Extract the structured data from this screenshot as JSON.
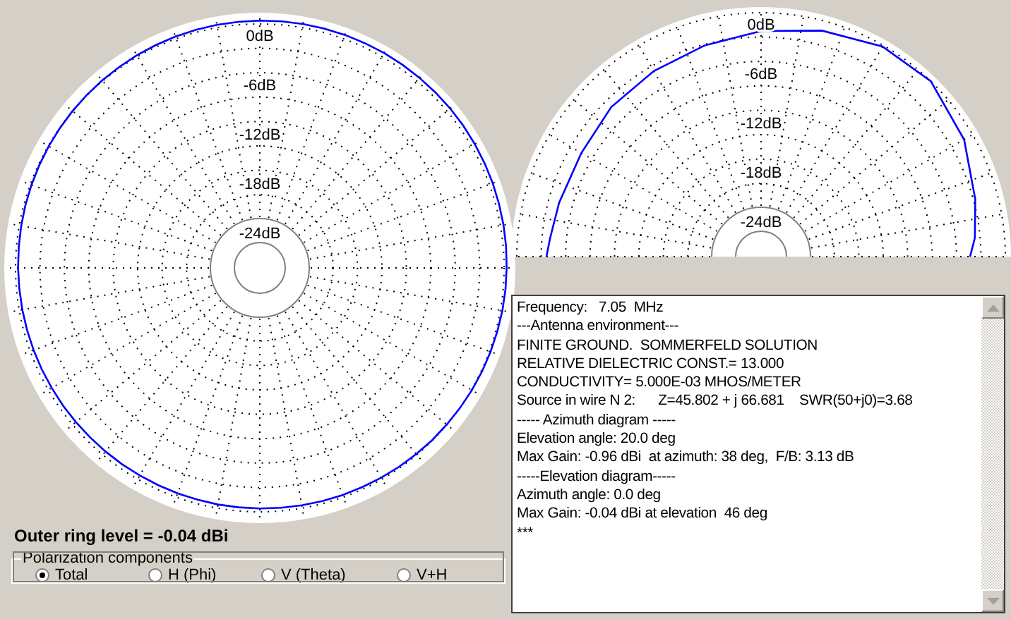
{
  "azimuth_plot": {
    "ring_labels": [
      "0dB",
      "-6dB",
      "-12dB",
      "-18dB",
      "-24dB"
    ]
  },
  "elevation_plot": {
    "ring_labels": [
      "0dB",
      "-6dB",
      "-12dB",
      "-18dB",
      "-24dB"
    ]
  },
  "outer_ring_level": "Outer ring level = -0.04 dBi",
  "polarization": {
    "title": "Polarization components",
    "options": [
      {
        "label": "Total",
        "selected": true
      },
      {
        "label": "H (Phi)",
        "selected": false
      },
      {
        "label": "V (Theta)",
        "selected": false
      },
      {
        "label": "V+H",
        "selected": false
      }
    ]
  },
  "results_text": [
    "Frequency:   7.05  MHz",
    "---Antenna environment---",
    "FINITE GROUND.  SOMMERFELD SOLUTION",
    "RELATIVE DIELECTRIC CONST.= 13.000",
    "CONDUCTIVITY= 5.000E-03 MHOS/METER",
    "Source in wire N 2:      Z=45.802 + j 66.681    SWR(50+j0)=3.68",
    "----- Azimuth diagram -----",
    "Elevation angle: 20.0 deg",
    "Max Gain: -0.96 dBi  at azimuth: 38 deg,  F/B: 3.13 dB",
    "-----Elevation diagram-----",
    "Azimuth angle: 0.0 deg",
    "Max Gain: -0.04 dBi at elevation  46 deg",
    "***"
  ]
}
